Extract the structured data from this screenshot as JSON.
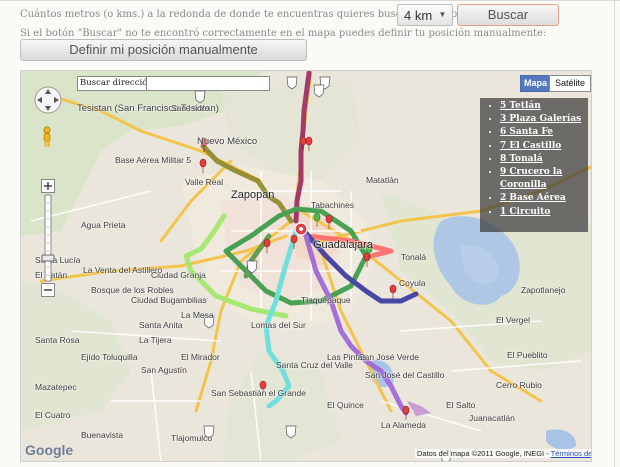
{
  "form": {
    "question": "Cuántos metros (o kms.) a la redonda de donde te encuentras quieres buscar rutas nocturnas:",
    "distance_selected": "4 km",
    "search_button": "Buscar",
    "hint": "Si el botón \"Buscar\" no te encontró correctamente en el mapa puedes definir tu posición manualmente:",
    "define_button": "Definir mi posición manualmente"
  },
  "map": {
    "search_label": "Buscar dirección:",
    "search_value": "",
    "map_types": [
      "Mapa",
      "Satélite"
    ],
    "active_map_type": "Mapa",
    "logo": "Google",
    "copyright": "Datos del mapa ©2011 Google, INEGI -",
    "terms_link": "Términos de uso",
    "places": {
      "tesistan": "Tesistan (San Francisco Tesistan)",
      "san_isidro": "San Isidro",
      "nuevo_mexico": "Nuevo México",
      "base_aerea": "Base Aérea Militar 5",
      "vallarta": "Valle Real",
      "zapopan": "Zapopan",
      "tabachines": "Tabachines",
      "agua_prieta": "Agua Prieta",
      "matatlan": "Matatlán",
      "santa_lucia": "Santa Lucía",
      "el_batan": "El Batán",
      "la_venta": "La Venta del Astillero",
      "ciudad_granja": "Ciudad Granja",
      "bosque_roble": "Bosque de los Robles",
      "tlaquepaque": "Tlaquepaque",
      "guadalajara": "Guadalajara",
      "tonala": "Tonalá",
      "coyula": "Coyula",
      "el_salto": "El Salto",
      "zapotlanejo": "Zapotlanejo",
      "tlajomulco": "Tlajomulco",
      "la_alameda": "La Alameda",
      "santa_cruz": "Santa Cruz del Valle",
      "san_sebastian": "San Sebastián el Grande",
      "san_agustin": "San Agustín",
      "mazatepec": "Mazatepec",
      "san_jose_verde": "San José Verde",
      "san_jose_castillo": "San José del Castillo",
      "juanacatlan": "Juanacatlán",
      "las_pintas": "Las Pintas",
      "el_quince": "El Quince",
      "cerro_rubio": "Cerro Rubio",
      "la_tijera": "La Tijera",
      "el_mirador": "El Mirador",
      "santa_anita": "Santa Anita",
      "ciudad_bugambilias": "Ciudad Bugambilias",
      "ejido": "Ejido Toluquilla",
      "el_pueblito": "El Pueblito",
      "lomas": "Lomas del Sur",
      "la_mesa": "La Mesa",
      "el_vergel": "El Vergel",
      "el_cuatro": "El Cuatro",
      "buenavista": "Buenavista",
      "santa_rosa": "Santa Rosa"
    },
    "legend": [
      "5 Tetlán",
      "3 Plaza Galerías",
      "6 Santa Fe",
      "7 El Castillo",
      "8 Tonalá",
      "9 Crucero la Coronilla",
      "2 Base Aérea",
      "1 Circuito"
    ],
    "route_colors": [
      "#3a9b4a",
      "#9c2c66",
      "#8f8a2e",
      "#a0e86a",
      "#5a9a4a",
      "#3a3aa0",
      "#9e66d6",
      "#66e0e0",
      "#ff6a6a",
      "#c08ad0"
    ]
  }
}
